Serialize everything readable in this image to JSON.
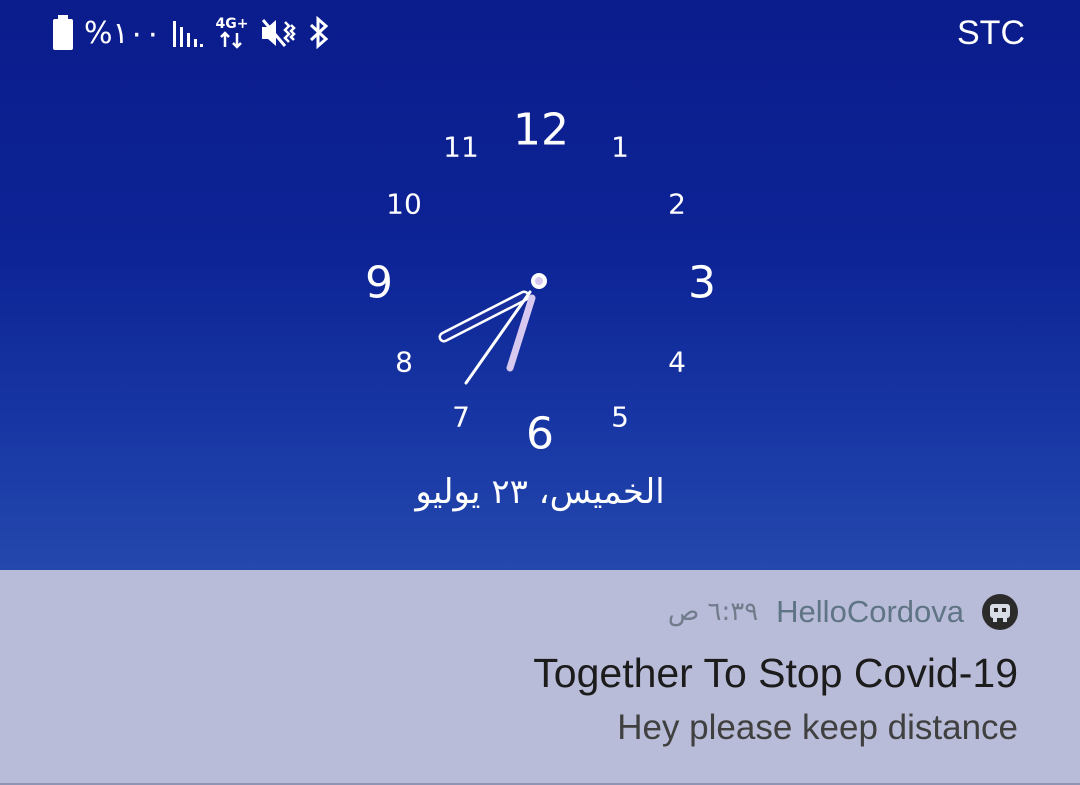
{
  "status_bar": {
    "battery_percent": "%١٠٠",
    "network_type": "4G+",
    "carrier": "STC",
    "icons": [
      "battery-icon",
      "signal-icon",
      "data-4g-icon",
      "mute-vibrate-icon",
      "bluetooth-icon"
    ]
  },
  "clock": {
    "numbers": [
      "12",
      "1",
      "2",
      "3",
      "4",
      "5",
      "6",
      "7",
      "8",
      "9",
      "10",
      "11"
    ],
    "time": "6:39",
    "date": "الخميس، ٢٣ يوليو"
  },
  "notification": {
    "app_icon": "cordova-robot-icon",
    "app_name": "HelloCordova",
    "time": "٦:٣٩ ص",
    "title": "Together To Stop Covid-19",
    "body": "Hey please keep distance"
  },
  "colors": {
    "lockscreen_top": "#0b1c8c",
    "lockscreen_bottom": "#2448ad",
    "notification_bg": "#b8bcd8",
    "hand_accent": "#d7c8f0"
  }
}
